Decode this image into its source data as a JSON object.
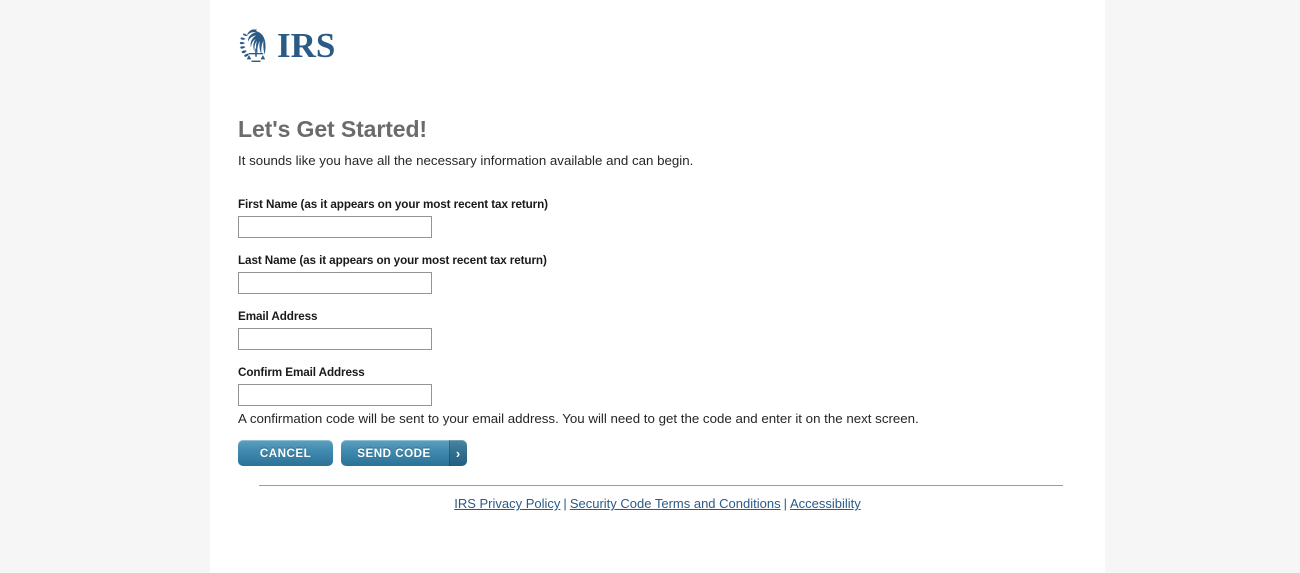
{
  "brand": {
    "logo_icon": "irs-eagle-scales-logo-icon",
    "logo_text": "IRS"
  },
  "page": {
    "title": "Let's Get Started!",
    "intro": "It sounds like you have all the necessary information available and can begin.",
    "note": "A confirmation code will be sent to your email address. You will need to get the code and enter it on the next screen."
  },
  "form": {
    "fields": [
      {
        "label": "First Name (as it appears on your most recent tax return)",
        "value": "",
        "placeholder": ""
      },
      {
        "label": "Last Name (as it appears on your most recent tax return)",
        "value": "",
        "placeholder": ""
      },
      {
        "label": "Email Address",
        "value": "",
        "placeholder": ""
      },
      {
        "label": "Confirm Email Address",
        "value": "",
        "placeholder": ""
      }
    ]
  },
  "buttons": {
    "cancel_label": "CANCEL",
    "send_label": "SEND CODE",
    "send_arrow_icon": "chevron-right-icon",
    "send_arrow_glyph": "›"
  },
  "footer": {
    "links": [
      {
        "label": "IRS Privacy Policy"
      },
      {
        "label": "Security Code Terms and Conditions"
      },
      {
        "label": "Accessibility"
      }
    ],
    "separator": "|"
  },
  "colors": {
    "brand_blue": "#2a5b87",
    "button_blue": "#418bb0",
    "heading_gray": "#6b6b6b",
    "page_background": "#ffffff",
    "gutter_background": "#f6f6f6",
    "input_border": "#949494",
    "divider": "#9b9b9b"
  }
}
